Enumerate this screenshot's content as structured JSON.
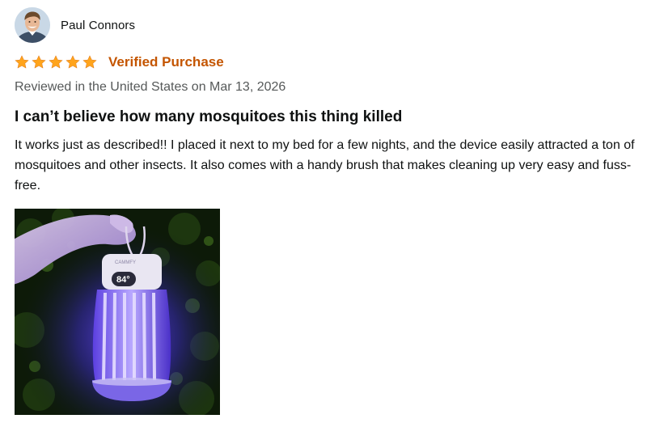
{
  "review": {
    "author": "Paul Connors",
    "rating": 5,
    "rating_max": 5,
    "verified_label": "Verified Purchase",
    "date_line": "Reviewed in the United States on Mar 13, 2026",
    "title": "I can’t believe how many mosquitoes this thing killed",
    "body": "It works just as described!! I placed it next to my bed for a few nights, and the device easily attracted a ton of mosquitoes and other insects. It also comes with a handy brush that makes cleaning up very easy and fuss-free.",
    "photo": {
      "device_brand": "CAMMFY",
      "battery_readout": "84°"
    }
  },
  "colors": {
    "star": "#ffa41c",
    "verified": "#c45500",
    "secondary_text": "#565959",
    "uv_glow": "#6a4cff"
  }
}
